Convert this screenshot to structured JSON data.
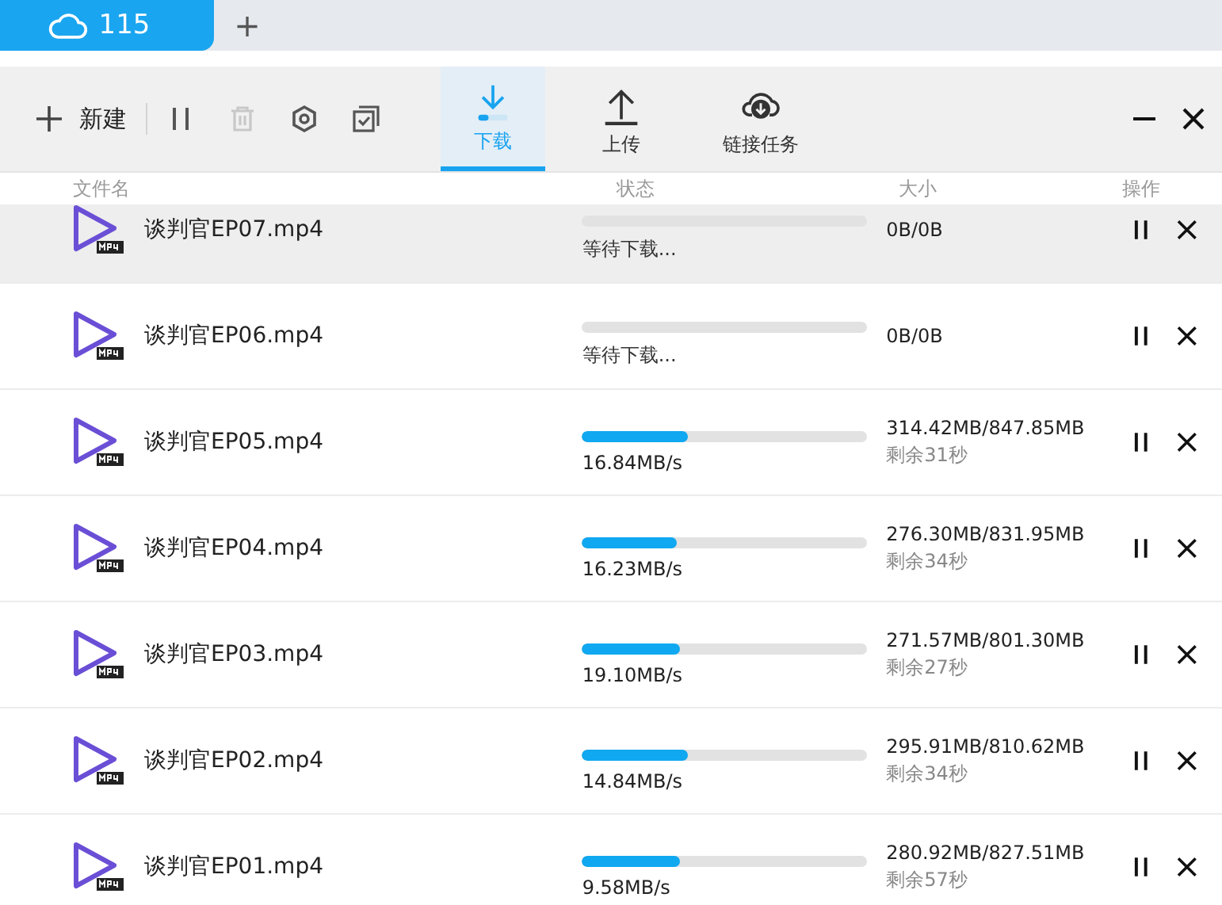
{
  "browser_tabs": [
    {
      "label": "115",
      "selected": true
    }
  ],
  "new_tab": "+",
  "toolbar": {
    "new_label": "新建",
    "delete_disabled": true
  },
  "view_tabs": [
    {
      "label": "下载",
      "kind": "download",
      "selected": true
    },
    {
      "label": "上传",
      "kind": "upload",
      "selected": false
    },
    {
      "label": "链接任务",
      "kind": "link",
      "selected": false
    }
  ],
  "table": {
    "columns": [
      "文件名",
      "状态",
      "大小",
      "操作"
    ],
    "rows": [
      {
        "name": "谈判官EP07.mp4",
        "kind": "waiting",
        "status": "等待下载...",
        "size": "0B/0B",
        "selected": true
      },
      {
        "name": "谈判官EP06.mp4",
        "kind": "waiting",
        "status": "等待下载...",
        "size": "0B/0B",
        "selected": false
      },
      {
        "name": "谈判官EP05.mp4",
        "kind": "downloading",
        "status": "16.84MB/s",
        "level": 0.37,
        "size": "314.42MB/847.85MB",
        "remaining": "剩余31秒",
        "selected": false
      },
      {
        "name": "谈判官EP04.mp4",
        "kind": "downloading",
        "status": "16.23MB/s",
        "level": 0.33,
        "size": "276.30MB/831.95MB",
        "remaining": "剩余34秒",
        "selected": false
      },
      {
        "name": "谈判官EP03.mp4",
        "kind": "downloading",
        "status": "19.10MB/s",
        "level": 0.34,
        "size": "271.57MB/801.30MB",
        "remaining": "剩余27秒",
        "selected": false
      },
      {
        "name": "谈判官EP02.mp4",
        "kind": "downloading",
        "status": "14.84MB/s",
        "level": 0.37,
        "size": "295.91MB/810.62MB",
        "remaining": "剩余34秒",
        "selected": false
      },
      {
        "name": "谈判官EP01.mp4",
        "kind": "downloading",
        "status": "9.58MB/s",
        "level": 0.34,
        "size": "280.92MB/827.51MB",
        "remaining": "剩余57秒",
        "selected": false
      }
    ]
  }
}
